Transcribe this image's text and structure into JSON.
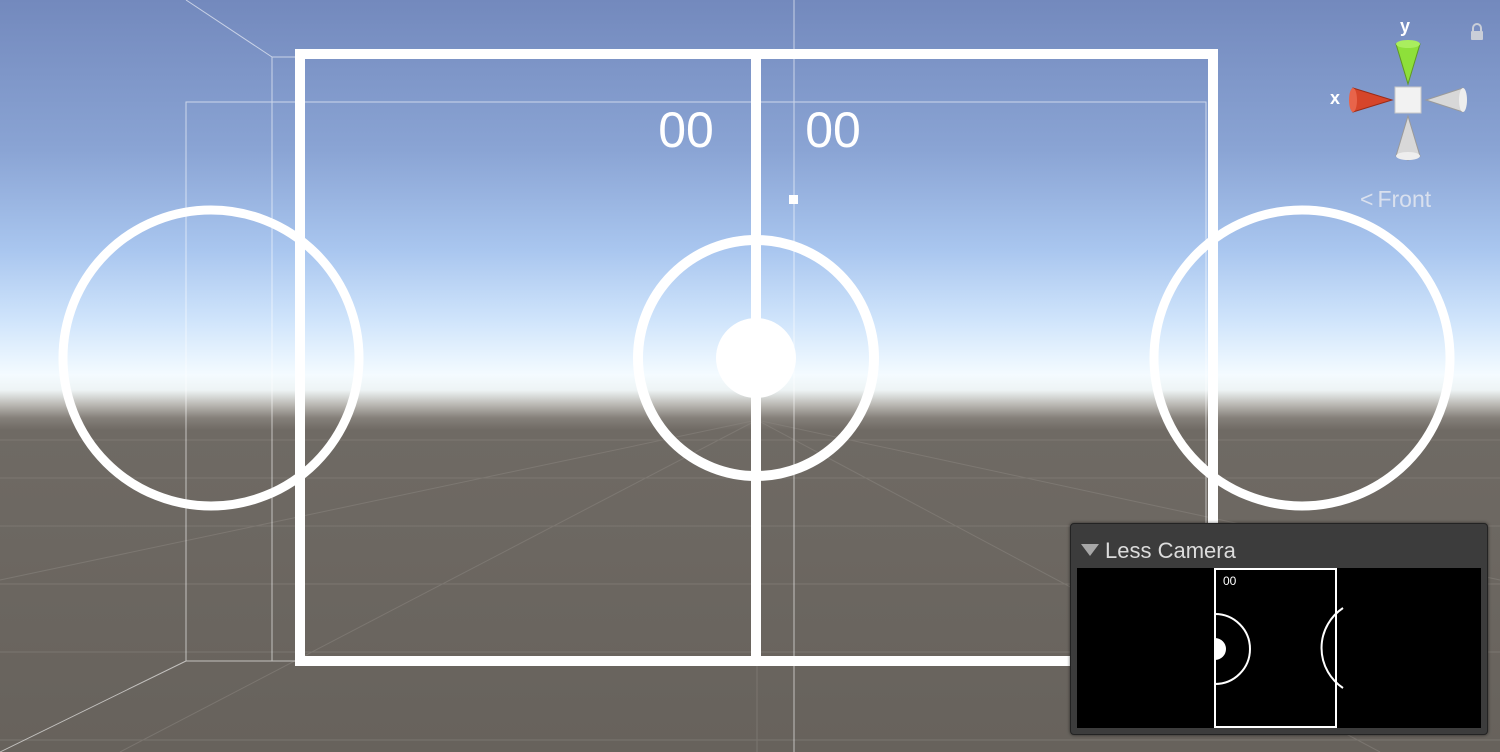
{
  "scoreboard": {
    "left_score": "00",
    "right_score": "00"
  },
  "gizmo": {
    "y_label": "y",
    "x_label": "x",
    "view_name": "Front",
    "colors": {
      "y_axis": "#8ee03a",
      "x_axis": "#d6452a",
      "neutral": "#d8d8d8"
    }
  },
  "camera_preview": {
    "title": "Less Camera",
    "score": "00",
    "foldout_icon": "triangle-down-icon"
  },
  "colors": {
    "field_lines": "#ffffff",
    "sky_top": "#7389bd",
    "horizon": "#f4fbff",
    "ground": "#67625c",
    "panel_bg": "#3c3c3c"
  }
}
